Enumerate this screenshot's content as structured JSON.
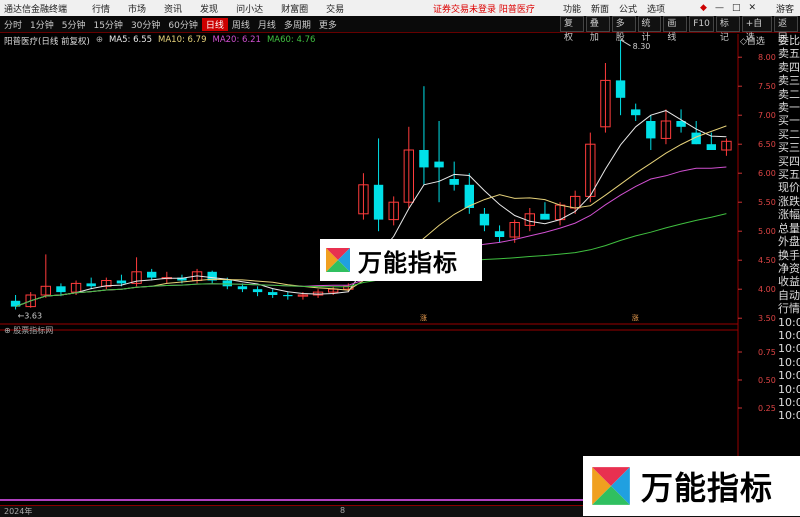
{
  "titlebar": {
    "app_name": "通达信金融终端",
    "menu": [
      "行情",
      "市场",
      "资讯",
      "发现",
      "问小达",
      "财富圈",
      "交易"
    ],
    "status": "证券交易未登录",
    "stock": "阳普医疗",
    "right_links": [
      "功能",
      "新面",
      "公式",
      "选项"
    ],
    "guest": "游客"
  },
  "periods": [
    "分时",
    "1分钟",
    "5分钟",
    "15分钟",
    "30分钟",
    "60分钟",
    "日线",
    "周线",
    "月线",
    "多周期",
    "更多"
  ],
  "active_period": "日线",
  "toolbar": [
    "复权",
    "叠加",
    "多股",
    "统计",
    "画线",
    "F10",
    "标记",
    "+自选",
    "返回"
  ],
  "info": {
    "title": "阳普医疗(日线 前复权)",
    "ma5": "MA5: 6.55",
    "ma10": "MA10: 6.79",
    "ma20": "MA20: 6.21",
    "ma60": "MA60: 4.76"
  },
  "colors": {
    "ma5": "#e8e8e8",
    "ma10": "#e6d27a",
    "ma20": "#d050d0",
    "ma60": "#40c040",
    "up": "#ff3c3c",
    "down": "#00e0e8"
  },
  "legend_label": "◇自选",
  "right_panel": [
    "委比",
    "卖五",
    "卖四",
    "卖三",
    "卖二",
    "卖一",
    "买一",
    "买二",
    "买三",
    "买四",
    "买五",
    "现价",
    "涨跌",
    "涨幅",
    "总量",
    "外盘",
    "换手",
    "净资",
    "收益",
    "自动",
    "行情",
    "10:0",
    "10:0",
    "10:0",
    "10:0",
    "10:0",
    "10:0",
    "10:0",
    "10:0"
  ],
  "sub_indicator": "股票指标网",
  "time_axis": {
    "start": "2024年",
    "mid": "8"
  },
  "watermark": "万能指标",
  "chart_data": {
    "type": "candlestick",
    "price_axis": [
      "8.00",
      "7.50",
      "7.00",
      "6.50",
      "6.00",
      "5.50",
      "5.00",
      "4.50",
      "4.00",
      "3.50"
    ],
    "sub_axis": [
      "0.75",
      "0.50",
      "0.25"
    ],
    "high_label": "8.30",
    "low_label": "3.63",
    "markers": [
      "涨",
      "涨"
    ],
    "ylim": [
      3.4,
      8.4
    ],
    "candles": [
      {
        "o": 3.8,
        "h": 3.9,
        "l": 3.65,
        "c": 3.7
      },
      {
        "o": 3.7,
        "h": 3.95,
        "l": 3.68,
        "c": 3.9
      },
      {
        "o": 3.9,
        "h": 4.6,
        "l": 3.85,
        "c": 4.05
      },
      {
        "o": 4.05,
        "h": 4.1,
        "l": 3.88,
        "c": 3.95
      },
      {
        "o": 3.95,
        "h": 4.15,
        "l": 3.9,
        "c": 4.1
      },
      {
        "o": 4.1,
        "h": 4.2,
        "l": 4.0,
        "c": 4.05
      },
      {
        "o": 4.05,
        "h": 4.2,
        "l": 4.0,
        "c": 4.15
      },
      {
        "o": 4.15,
        "h": 4.25,
        "l": 4.05,
        "c": 4.1
      },
      {
        "o": 4.1,
        "h": 4.55,
        "l": 4.05,
        "c": 4.3
      },
      {
        "o": 4.3,
        "h": 4.35,
        "l": 4.15,
        "c": 4.2
      },
      {
        "o": 4.2,
        "h": 4.3,
        "l": 4.1,
        "c": 4.2
      },
      {
        "o": 4.2,
        "h": 4.25,
        "l": 4.1,
        "c": 4.15
      },
      {
        "o": 4.15,
        "h": 4.35,
        "l": 4.1,
        "c": 4.3
      },
      {
        "o": 4.3,
        "h": 4.32,
        "l": 4.1,
        "c": 4.15
      },
      {
        "o": 4.15,
        "h": 4.2,
        "l": 4.0,
        "c": 4.05
      },
      {
        "o": 4.05,
        "h": 4.1,
        "l": 3.95,
        "c": 4.0
      },
      {
        "o": 4.0,
        "h": 4.05,
        "l": 3.88,
        "c": 3.95
      },
      {
        "o": 3.95,
        "h": 4.0,
        "l": 3.85,
        "c": 3.9
      },
      {
        "o": 3.9,
        "h": 3.95,
        "l": 3.82,
        "c": 3.88
      },
      {
        "o": 3.88,
        "h": 3.95,
        "l": 3.82,
        "c": 3.9
      },
      {
        "o": 3.9,
        "h": 4.0,
        "l": 3.85,
        "c": 3.95
      },
      {
        "o": 3.95,
        "h": 4.05,
        "l": 3.9,
        "c": 4.0
      },
      {
        "o": 4.0,
        "h": 4.1,
        "l": 3.95,
        "c": 4.05
      },
      {
        "o": 5.3,
        "h": 6.0,
        "l": 5.2,
        "c": 5.8
      },
      {
        "o": 5.8,
        "h": 6.6,
        "l": 5.0,
        "c": 5.2
      },
      {
        "o": 5.2,
        "h": 5.6,
        "l": 5.1,
        "c": 5.5
      },
      {
        "o": 5.5,
        "h": 6.8,
        "l": 5.4,
        "c": 6.4
      },
      {
        "o": 6.4,
        "h": 7.5,
        "l": 5.8,
        "c": 6.1
      },
      {
        "o": 6.2,
        "h": 6.9,
        "l": 5.5,
        "c": 6.1
      },
      {
        "o": 5.9,
        "h": 6.2,
        "l": 5.7,
        "c": 5.8
      },
      {
        "o": 5.8,
        "h": 6.0,
        "l": 5.3,
        "c": 5.4
      },
      {
        "o": 5.3,
        "h": 5.4,
        "l": 5.0,
        "c": 5.1
      },
      {
        "o": 5.0,
        "h": 5.1,
        "l": 4.8,
        "c": 4.9
      },
      {
        "o": 4.9,
        "h": 5.2,
        "l": 4.8,
        "c": 5.15
      },
      {
        "o": 5.1,
        "h": 5.4,
        "l": 5.0,
        "c": 5.3
      },
      {
        "o": 5.3,
        "h": 5.5,
        "l": 5.2,
        "c": 5.2
      },
      {
        "o": 5.2,
        "h": 5.5,
        "l": 5.1,
        "c": 5.45
      },
      {
        "o": 5.4,
        "h": 5.7,
        "l": 5.3,
        "c": 5.6
      },
      {
        "o": 5.6,
        "h": 6.7,
        "l": 5.5,
        "c": 6.5
      },
      {
        "o": 6.8,
        "h": 7.9,
        "l": 6.7,
        "c": 7.6
      },
      {
        "o": 7.6,
        "h": 8.3,
        "l": 7.0,
        "c": 7.3
      },
      {
        "o": 7.1,
        "h": 7.2,
        "l": 6.9,
        "c": 7.0
      },
      {
        "o": 6.9,
        "h": 7.0,
        "l": 6.4,
        "c": 6.6
      },
      {
        "o": 6.6,
        "h": 7.1,
        "l": 6.5,
        "c": 6.9
      },
      {
        "o": 6.9,
        "h": 7.1,
        "l": 6.7,
        "c": 6.8
      },
      {
        "o": 6.7,
        "h": 6.9,
        "l": 6.5,
        "c": 6.5
      },
      {
        "o": 6.5,
        "h": 6.7,
        "l": 6.4,
        "c": 6.4
      },
      {
        "o": 6.4,
        "h": 6.6,
        "l": 6.3,
        "c": 6.55
      }
    ]
  }
}
